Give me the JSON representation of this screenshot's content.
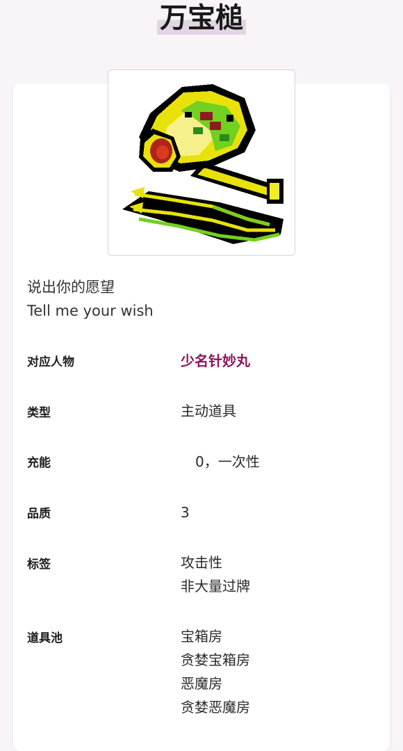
{
  "page": {
    "title": "万宝槌"
  },
  "item": {
    "image_icon": "miracle-mallet-pixel-icon",
    "quote_cn": "说出你的愿望",
    "quote_en": "Tell me your wish"
  },
  "info": {
    "character": {
      "label": "对应人物",
      "value": "少名针妙丸"
    },
    "type": {
      "label": "类型",
      "value": "主动道具"
    },
    "charge": {
      "label": "充能",
      "value": "0，一次性"
    },
    "quality": {
      "label": "品质",
      "value": "3"
    },
    "tags": {
      "label": "标签",
      "values": [
        "攻击性",
        "非大量过牌"
      ]
    },
    "pools": {
      "label": "道具池",
      "values": [
        "宝箱房",
        "贪婪宝箱房",
        "恶魔房",
        "贪婪恶魔房"
      ]
    }
  },
  "colors": {
    "accent_link": "#8e1459",
    "title_highlight": "#e2d6e4",
    "page_background": "#f8f4f8"
  }
}
